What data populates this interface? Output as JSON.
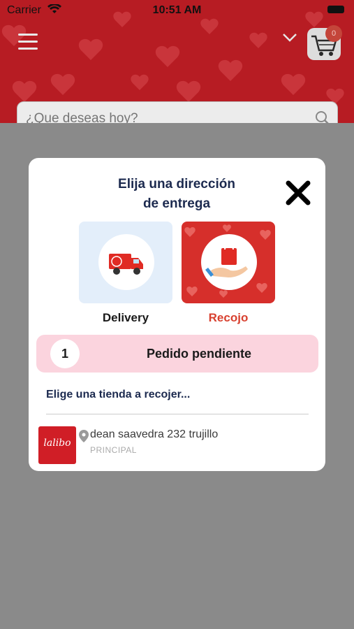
{
  "status_bar": {
    "carrier": "Carrier",
    "time": "10:51 AM"
  },
  "header": {
    "cart_count": "0"
  },
  "search": {
    "placeholder": "¿Que deseas hoy?"
  },
  "modal": {
    "title_line1": "Elija una dirección",
    "title_line2": "de entrega",
    "options": [
      {
        "label": "Delivery",
        "icon": "truck-icon",
        "selected": false
      },
      {
        "label": "Recojo",
        "icon": "shopping-bag-hand-icon",
        "selected": true
      }
    ],
    "pending": {
      "count": "1",
      "label": "Pedido pendiente"
    },
    "choose_store": "Elige una tienda a recojer...",
    "stores": [
      {
        "logo_text": "lalibo",
        "address": "dean saavedra 232 trujillo",
        "tag": "PRINCIPAL"
      }
    ]
  },
  "colors": {
    "brand_red": "#b71c23",
    "accent_red": "#d8402f",
    "pending_pink": "#fbd4de",
    "title_navy": "#1c2a4f"
  }
}
